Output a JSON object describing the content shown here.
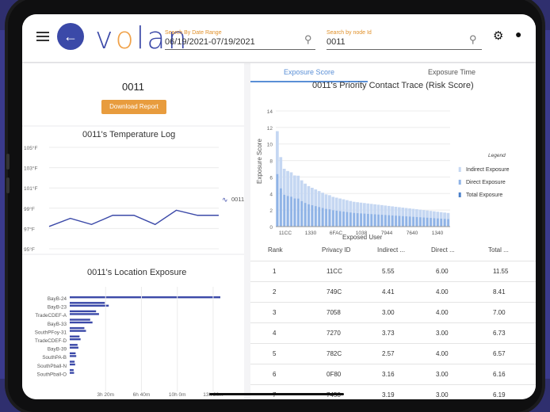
{
  "header": {
    "app_logo": "volan",
    "date_range_label": "Search By Date Range",
    "date_range_value": "06/19/2021-07/19/2021",
    "node_label": "Search by node Id",
    "node_value": "0011"
  },
  "node_card": {
    "title": "0011",
    "download_label": "Download Report"
  },
  "temperature_log": {
    "title": "0011's Temperature Log",
    "legend": "0011",
    "y_ticks": [
      "105°F",
      "103°F",
      "101°F",
      "99°F",
      "97°F",
      "95°F"
    ]
  },
  "location_exposure": {
    "title": "0011's Location Exposure",
    "x_ticks": [
      "3h 20m",
      "6h 40m",
      "10h 0m",
      "13h 20m"
    ]
  },
  "tabs": [
    {
      "label": "Exposure Score"
    },
    {
      "label": "Exposure Time"
    }
  ],
  "priority_chart": {
    "title": "0011's Priority Contact Trace (Risk Score)",
    "ylabel": "Exposure Score",
    "xlabel": "Exposed User",
    "legend_title": "Legend",
    "legend_items": [
      "Indirect Exposure",
      "Direct Exposure",
      "Total Exposure"
    ],
    "x_ticks": [
      "11CC",
      "1330",
      "6FAC",
      "1038",
      "7944",
      "7640",
      "1340"
    ],
    "y_ticks": [
      "0",
      "2",
      "4",
      "6",
      "8",
      "10",
      "12",
      "14"
    ]
  },
  "table": {
    "columns": [
      "Rank",
      "Privacy ID",
      "Indirect ...",
      "Direct ...",
      "Total ..."
    ],
    "rows": [
      {
        "rank": "1",
        "id": "11CC",
        "indirect": "5.55",
        "direct": "6.00",
        "total": "11.55"
      },
      {
        "rank": "2",
        "id": "749C",
        "indirect": "4.41",
        "direct": "4.00",
        "total": "8.41"
      },
      {
        "rank": "3",
        "id": "7058",
        "indirect": "3.00",
        "direct": "4.00",
        "total": "7.00"
      },
      {
        "rank": "4",
        "id": "7270",
        "indirect": "3.73",
        "direct": "3.00",
        "total": "6.73"
      },
      {
        "rank": "5",
        "id": "782C",
        "indirect": "2.57",
        "direct": "4.00",
        "total": "6.57"
      },
      {
        "rank": "6",
        "id": "0F80",
        "indirect": "3.16",
        "direct": "3.00",
        "total": "6.16"
      },
      {
        "rank": "7",
        "id": "7458",
        "indirect": "3.19",
        "direct": "3.00",
        "total": "6.19"
      }
    ]
  },
  "chart_data": [
    {
      "type": "line",
      "title": "0011's Temperature Log",
      "ylim": [
        95,
        105
      ],
      "yticks": [
        "105°F",
        "103°F",
        "101°F",
        "99°F",
        "97°F",
        "95°F"
      ],
      "series": [
        {
          "name": "0011",
          "values": [
            97.2,
            98.0,
            97.4,
            98.3,
            98.3,
            97.4,
            98.8,
            98.3,
            98.3
          ]
        }
      ],
      "color": "#3b49a8"
    },
    {
      "type": "bar",
      "orientation": "horizontal",
      "title": "0011's Location Exposure",
      "categories": [
        "BayB-24",
        "BayB-23",
        "TradeCDEF-A",
        "BayB-33",
        "SouthPFoy-31",
        "TradeCDEF-D",
        "BayB-39",
        "SouthPA-B",
        "SouthPball-N",
        "SouthPball-O"
      ],
      "values": [
        13.9,
        3.6,
        2.7,
        2.1,
        1.5,
        1.0,
        0.8,
        0.6,
        0.5,
        0.4
      ],
      "value_unit": "hours",
      "x_ticks": [
        "3h 20m",
        "6h 40m",
        "10h 0m",
        "13h 20m"
      ],
      "color": "#3b49a8"
    },
    {
      "type": "bar",
      "title": "0011's Priority Contact Trace (Risk Score)",
      "ylabel": "Exposure Score",
      "xlabel": "Exposed User",
      "ylim": [
        0,
        14
      ],
      "x_ticks": [
        "11CC",
        "1330",
        "6FAC",
        "1038",
        "7944",
        "7640",
        "1340"
      ],
      "series": [
        {
          "name": "Total Exposure",
          "values": [
            11.55,
            8.41,
            7.0,
            6.73,
            6.57,
            6.19,
            6.16,
            5.6,
            5.2,
            4.9,
            4.7,
            4.5,
            4.3,
            4.1,
            3.9,
            3.8,
            3.6,
            3.5,
            3.4,
            3.3,
            3.2,
            3.1,
            3.0,
            2.95,
            2.9,
            2.85,
            2.8,
            2.75,
            2.7,
            2.65,
            2.6,
            2.55,
            2.5,
            2.45,
            2.4,
            2.35,
            2.3,
            2.25,
            2.2,
            2.15,
            2.1,
            2.05,
            2.0,
            1.95,
            1.9,
            1.85,
            1.8,
            1.75,
            1.7,
            1.65
          ]
        }
      ],
      "legend": [
        "Indirect Exposure",
        "Direct Exposure",
        "Total Exposure"
      ],
      "colors": {
        "indirect": "#c5d7f2",
        "direct": "#8fb3e6",
        "total": "#4a7fc9"
      }
    }
  ]
}
